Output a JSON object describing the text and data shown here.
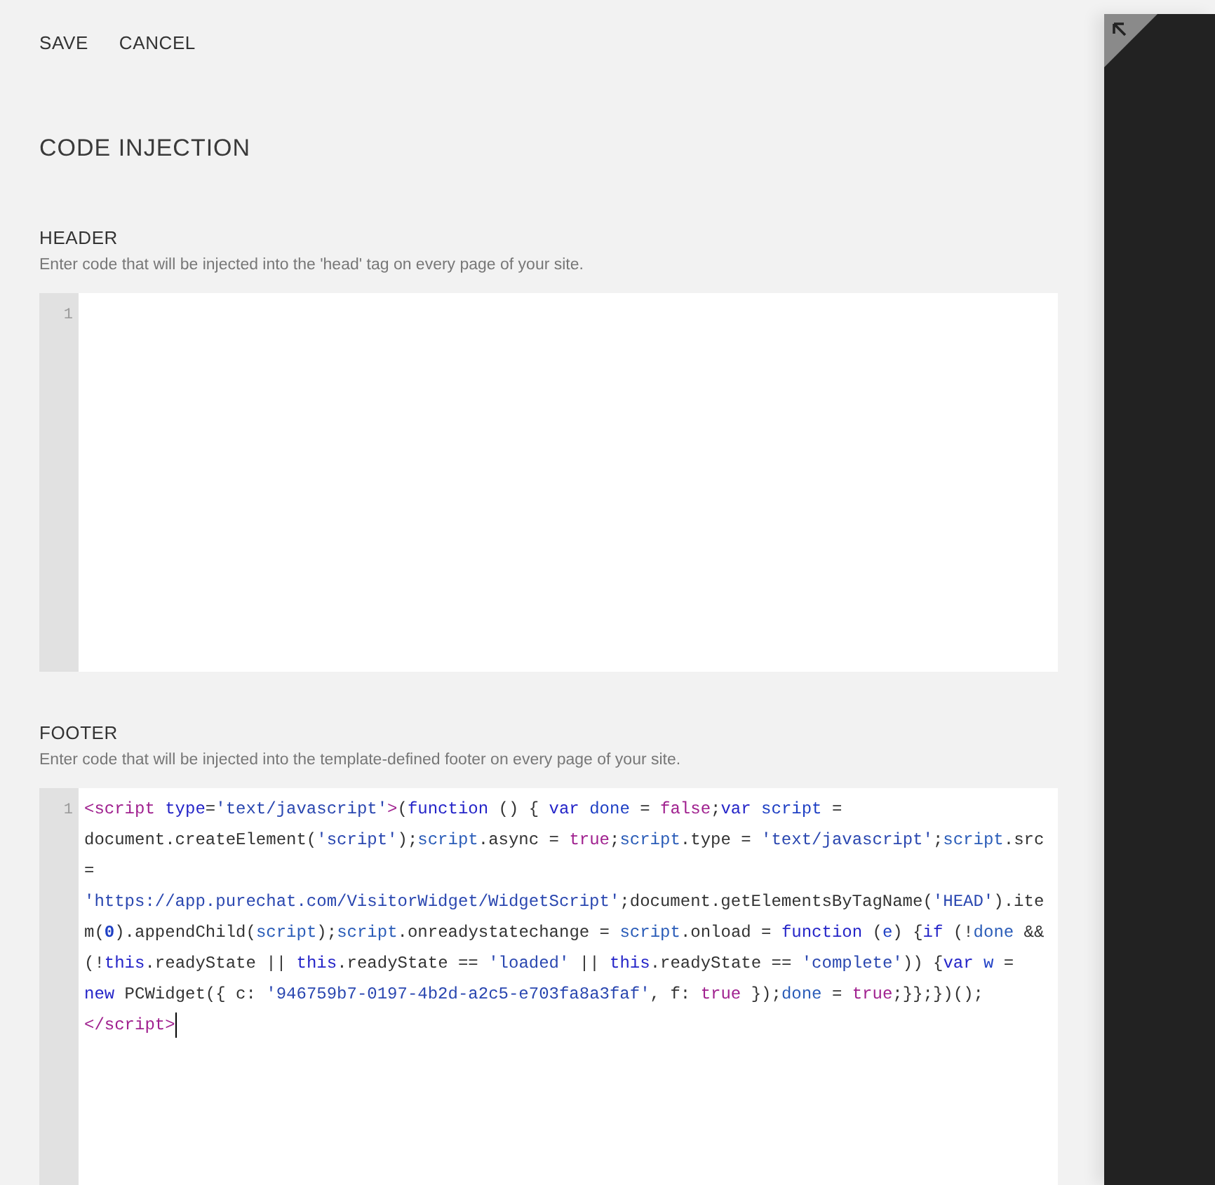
{
  "toolbar": {
    "buttons": [
      "SAVE",
      "CANCEL"
    ]
  },
  "title": "CODE INJECTION",
  "sections": [
    {
      "heading": "HEADER",
      "description": "Enter code that will be injected into the 'head' tag on every page of your site.",
      "editor": {
        "line_numbers": [
          "1"
        ]
      }
    },
    {
      "heading": "FOOTER",
      "description": "Enter code that will be injected into the template-defined footer on every page of your site.",
      "editor": {
        "line_numbers": [
          "1"
        ],
        "tokens": [
          {
            "kind": "tag",
            "text": "<script "
          },
          {
            "kind": "attr",
            "text": "type"
          },
          {
            "kind": "plain",
            "text": "="
          },
          {
            "kind": "string",
            "text": "'text/javascript'"
          },
          {
            "kind": "tag",
            "text": ">"
          },
          {
            "kind": "plain",
            "text": "("
          },
          {
            "kind": "keyword",
            "text": "function"
          },
          {
            "kind": "plain",
            "text": " () { "
          },
          {
            "kind": "keyword",
            "text": "var "
          },
          {
            "kind": "def",
            "text": "done"
          },
          {
            "kind": "plain",
            "text": " = "
          },
          {
            "kind": "atom",
            "text": "false"
          },
          {
            "kind": "plain",
            "text": ";"
          },
          {
            "kind": "keyword",
            "text": "var "
          },
          {
            "kind": "def",
            "text": "script"
          },
          {
            "kind": "plain",
            "text": " = document.createElement("
          },
          {
            "kind": "string",
            "text": "'script'"
          },
          {
            "kind": "plain",
            "text": ");"
          },
          {
            "kind": "variable",
            "text": "script"
          },
          {
            "kind": "plain",
            "text": ".async = "
          },
          {
            "kind": "atom",
            "text": "true"
          },
          {
            "kind": "plain",
            "text": ";"
          },
          {
            "kind": "variable",
            "text": "script"
          },
          {
            "kind": "plain",
            "text": ".type = "
          },
          {
            "kind": "string",
            "text": "'text/javascript'"
          },
          {
            "kind": "plain",
            "text": ";"
          },
          {
            "kind": "variable",
            "text": "script"
          },
          {
            "kind": "plain",
            "text": ".src = "
          },
          {
            "kind": "string",
            "text": "'https://app.purechat.com/VisitorWidget/WidgetScript'"
          },
          {
            "kind": "plain",
            "text": ";document.getElementsByTagName("
          },
          {
            "kind": "string",
            "text": "'HEAD'"
          },
          {
            "kind": "plain",
            "text": ").item("
          },
          {
            "kind": "number",
            "text": "0"
          },
          {
            "kind": "plain",
            "text": ").appendChild("
          },
          {
            "kind": "variable",
            "text": "script"
          },
          {
            "kind": "plain",
            "text": ");"
          },
          {
            "kind": "variable",
            "text": "script"
          },
          {
            "kind": "plain",
            "text": ".onreadystatechange = "
          },
          {
            "kind": "variable",
            "text": "script"
          },
          {
            "kind": "plain",
            "text": ".onload = "
          },
          {
            "kind": "keyword",
            "text": "function"
          },
          {
            "kind": "plain",
            "text": " ("
          },
          {
            "kind": "def",
            "text": "e"
          },
          {
            "kind": "plain",
            "text": ") {"
          },
          {
            "kind": "keyword",
            "text": "if"
          },
          {
            "kind": "plain",
            "text": " (!"
          },
          {
            "kind": "variable",
            "text": "done"
          },
          {
            "kind": "plain",
            "text": " && "
          },
          {
            "kind": "plain",
            "text": "(!"
          },
          {
            "kind": "keyword",
            "text": "this"
          },
          {
            "kind": "plain",
            "text": ".readyState || "
          },
          {
            "kind": "keyword",
            "text": "this"
          },
          {
            "kind": "plain",
            "text": ".readyState == "
          },
          {
            "kind": "string",
            "text": "'loaded'"
          },
          {
            "kind": "plain",
            "text": " || "
          },
          {
            "kind": "keyword",
            "text": "this"
          },
          {
            "kind": "plain",
            "text": ".readyState == "
          },
          {
            "kind": "string",
            "text": "'complete'"
          },
          {
            "kind": "plain",
            "text": ")) {"
          },
          {
            "kind": "keyword",
            "text": "var "
          },
          {
            "kind": "def",
            "text": "w"
          },
          {
            "kind": "plain",
            "text": " = "
          },
          {
            "kind": "keyword",
            "text": "new"
          },
          {
            "kind": "plain",
            "text": " PCWidget({ c: "
          },
          {
            "kind": "string",
            "text": "'946759b7-0197-4b2d-a2c5-e703fa8a3faf'"
          },
          {
            "kind": "plain",
            "text": ", f: "
          },
          {
            "kind": "atom",
            "text": "true"
          },
          {
            "kind": "plain",
            "text": " });"
          },
          {
            "kind": "variable",
            "text": "done"
          },
          {
            "kind": "plain",
            "text": " = "
          },
          {
            "kind": "atom",
            "text": "true"
          },
          {
            "kind": "plain",
            "text": ";}};})();"
          },
          {
            "kind": "tag",
            "text": "</script>"
          }
        ]
      }
    }
  ]
}
